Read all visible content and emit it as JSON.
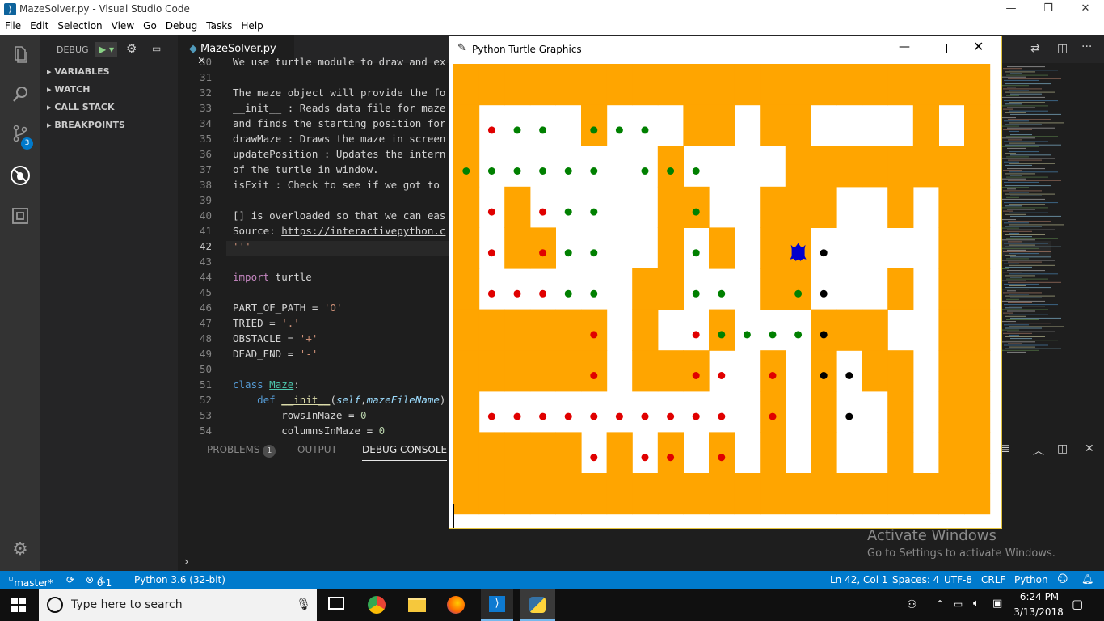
{
  "window_title": "MazeSolver.py - Visual Studio Code",
  "menu": [
    "File",
    "Edit",
    "Selection",
    "View",
    "Go",
    "Debug",
    "Tasks",
    "Help"
  ],
  "sidebar": {
    "debug_label": "DEBUG",
    "sections": [
      "VARIABLES",
      "WATCH",
      "CALL STACK",
      "BREAKPOINTS"
    ],
    "scm_badge": "3"
  },
  "editor_tab": {
    "name": "MazeSolver.py",
    "close": "×"
  },
  "code_lines": [
    {
      "n": "30",
      "t": "We use turtle module to draw and ex"
    },
    {
      "n": "31",
      "t": ""
    },
    {
      "n": "32",
      "t": "The maze object will provide the fo"
    },
    {
      "n": "33",
      "t": "__init__ : Reads data file for maze"
    },
    {
      "n": "34",
      "t": "and finds the starting position for"
    },
    {
      "n": "35",
      "t": "drawMaze : Draws the maze in screen"
    },
    {
      "n": "36",
      "t": "updatePosition : Updates the intern"
    },
    {
      "n": "37",
      "t": "of the turtle in window."
    },
    {
      "n": "38",
      "t": "isExit : Check to see if we got to"
    },
    {
      "n": "39",
      "t": ""
    },
    {
      "n": "40",
      "t": "[] is overloaded so that we can eas"
    },
    {
      "n": "41",
      "t": "Source: https://interactivepython.c"
    },
    {
      "n": "42",
      "t": "'''"
    },
    {
      "n": "43",
      "t": ""
    },
    {
      "n": "44",
      "t": "import turtle"
    },
    {
      "n": "45",
      "t": ""
    },
    {
      "n": "46",
      "t": "PART_OF_PATH = 'O'"
    },
    {
      "n": "47",
      "t": "TRIED = '.'"
    },
    {
      "n": "48",
      "t": "OBSTACLE = '+'"
    },
    {
      "n": "49",
      "t": "DEAD_END = '-'"
    },
    {
      "n": "50",
      "t": ""
    },
    {
      "n": "51",
      "t": "class Maze:"
    },
    {
      "n": "52",
      "t": "    def __init__(self,mazeFileName)"
    },
    {
      "n": "53",
      "t": "        rowsInMaze = 0"
    },
    {
      "n": "54",
      "t": "        columnsInMaze = 0"
    }
  ],
  "panel": {
    "tabs": [
      "PROBLEMS",
      "OUTPUT",
      "DEBUG CONSOLE"
    ],
    "problems_count": "1",
    "prompt": "›"
  },
  "turtle_window": {
    "title": "Python Turtle Graphics"
  },
  "maze": {
    "wall_color": "#ffa500",
    "open_color": "#ffffff",
    "rows": [
      "+++++++++++++++++++++",
      "+    +   ++ ++    + +",
      "+       +    ++++++++",
      "+ +     ++  +++  + ++",
      "+ ++    + + ++     ++",
      "+      ++   ++   + ++",
      "++++++ +  +   +++  ++",
      "++++++ +++  + + ++ ++",
      "+           + +  + ++",
      "+++++ + + + + +  + ++",
      "+++++++++++++++++++++"
    ],
    "dots": [
      {
        "c": 1,
        "r": 1,
        "col": "red"
      },
      {
        "c": 2,
        "r": 1,
        "col": "green"
      },
      {
        "c": 3,
        "r": 1,
        "col": "green"
      },
      {
        "c": 5,
        "r": 1,
        "col": "green"
      },
      {
        "c": 6,
        "r": 1,
        "col": "green"
      },
      {
        "c": 7,
        "r": 1,
        "col": "green"
      },
      {
        "c": 0,
        "r": 2,
        "col": "green"
      },
      {
        "c": 1,
        "r": 2,
        "col": "green"
      },
      {
        "c": 2,
        "r": 2,
        "col": "green"
      },
      {
        "c": 3,
        "r": 2,
        "col": "green"
      },
      {
        "c": 4,
        "r": 2,
        "col": "green"
      },
      {
        "c": 5,
        "r": 2,
        "col": "green"
      },
      {
        "c": 7,
        "r": 2,
        "col": "green"
      },
      {
        "c": 8,
        "r": 2,
        "col": "green"
      },
      {
        "c": 9,
        "r": 2,
        "col": "green"
      },
      {
        "c": 1,
        "r": 3,
        "col": "red"
      },
      {
        "c": 3,
        "r": 3,
        "col": "red"
      },
      {
        "c": 4,
        "r": 3,
        "col": "green"
      },
      {
        "c": 5,
        "r": 3,
        "col": "green"
      },
      {
        "c": 9,
        "r": 3,
        "col": "green"
      },
      {
        "c": 1,
        "r": 4,
        "col": "red"
      },
      {
        "c": 3,
        "r": 4,
        "col": "red"
      },
      {
        "c": 4,
        "r": 4,
        "col": "green"
      },
      {
        "c": 5,
        "r": 4,
        "col": "green"
      },
      {
        "c": 9,
        "r": 4,
        "col": "green"
      },
      {
        "c": 14,
        "r": 4,
        "col": "black"
      },
      {
        "c": 1,
        "r": 5,
        "col": "red"
      },
      {
        "c": 2,
        "r": 5,
        "col": "red"
      },
      {
        "c": 3,
        "r": 5,
        "col": "red"
      },
      {
        "c": 4,
        "r": 5,
        "col": "green"
      },
      {
        "c": 5,
        "r": 5,
        "col": "green"
      },
      {
        "c": 9,
        "r": 5,
        "col": "green"
      },
      {
        "c": 10,
        "r": 5,
        "col": "green"
      },
      {
        "c": 13,
        "r": 5,
        "col": "green"
      },
      {
        "c": 14,
        "r": 5,
        "col": "black"
      },
      {
        "c": 5,
        "r": 6,
        "col": "red"
      },
      {
        "c": 9,
        "r": 6,
        "col": "red"
      },
      {
        "c": 10,
        "r": 6,
        "col": "green"
      },
      {
        "c": 11,
        "r": 6,
        "col": "green"
      },
      {
        "c": 12,
        "r": 6,
        "col": "green"
      },
      {
        "c": 13,
        "r": 6,
        "col": "green"
      },
      {
        "c": 14,
        "r": 6,
        "col": "black"
      },
      {
        "c": 5,
        "r": 7,
        "col": "red"
      },
      {
        "c": 9,
        "r": 7,
        "col": "red"
      },
      {
        "c": 10,
        "r": 7,
        "col": "red"
      },
      {
        "c": 12,
        "r": 7,
        "col": "red"
      },
      {
        "c": 14,
        "r": 7,
        "col": "black"
      },
      {
        "c": 15,
        "r": 7,
        "col": "black"
      },
      {
        "c": 1,
        "r": 8,
        "col": "red"
      },
      {
        "c": 2,
        "r": 8,
        "col": "red"
      },
      {
        "c": 3,
        "r": 8,
        "col": "red"
      },
      {
        "c": 4,
        "r": 8,
        "col": "red"
      },
      {
        "c": 5,
        "r": 8,
        "col": "red"
      },
      {
        "c": 6,
        "r": 8,
        "col": "red"
      },
      {
        "c": 7,
        "r": 8,
        "col": "red"
      },
      {
        "c": 8,
        "r": 8,
        "col": "red"
      },
      {
        "c": 9,
        "r": 8,
        "col": "red"
      },
      {
        "c": 10,
        "r": 8,
        "col": "red"
      },
      {
        "c": 12,
        "r": 8,
        "col": "red"
      },
      {
        "c": 15,
        "r": 8,
        "col": "black"
      },
      {
        "c": 5,
        "r": 9,
        "col": "red"
      },
      {
        "c": 7,
        "r": 9,
        "col": "red"
      },
      {
        "c": 8,
        "r": 9,
        "col": "red"
      },
      {
        "c": 10,
        "r": 9,
        "col": "red"
      }
    ],
    "turtle": {
      "c": 13,
      "r": 4,
      "color": "#0000cc"
    }
  },
  "watermark": {
    "line1": "Activate Windows",
    "line2": "Go to Settings to activate Windows."
  },
  "status": {
    "branch": "master*",
    "errors": "0",
    "warnings": "1",
    "python": "Python 3.6 (32-bit)",
    "position": "Ln 42, Col 1",
    "spaces": "Spaces: 4",
    "encoding": "UTF-8",
    "eol": "CRLF",
    "language": "Python"
  },
  "taskbar": {
    "search_placeholder": "Type here to search",
    "time": "6:24 PM",
    "date": "3/13/2018"
  }
}
